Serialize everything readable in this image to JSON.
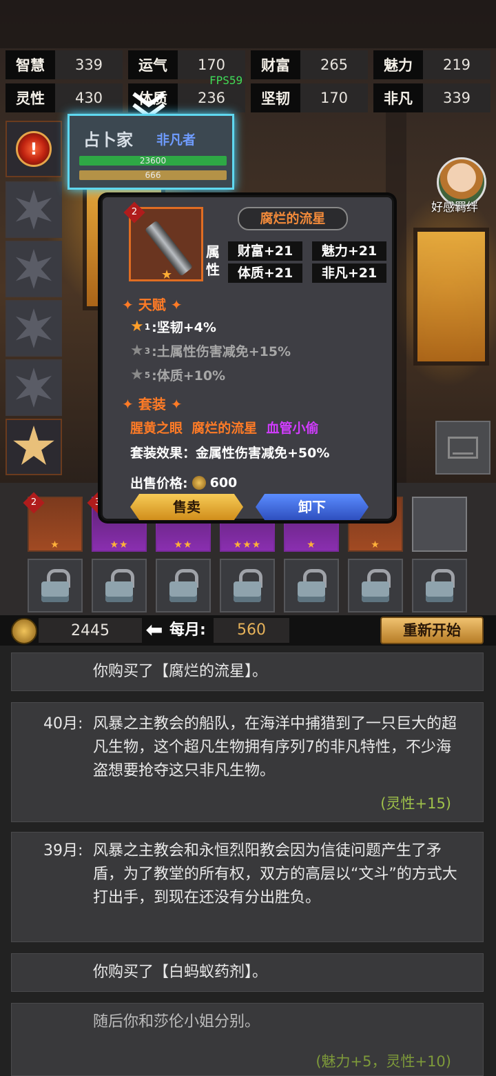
{
  "stats": [
    {
      "label": "智慧",
      "value": "339"
    },
    {
      "label": "运气",
      "value": "170"
    },
    {
      "label": "财富",
      "value": "265"
    },
    {
      "label": "魅力",
      "value": "219"
    },
    {
      "label": "灵性",
      "value": "430"
    },
    {
      "label": "体质",
      "value": "236"
    },
    {
      "label": "坚韧",
      "value": "170"
    },
    {
      "label": "非凡",
      "value": "339"
    }
  ],
  "fps": "FPS59",
  "character": {
    "title": "占卜家",
    "rank": "非凡者",
    "hp": "23600",
    "mp": "666"
  },
  "companion": {
    "label": "好感羁绊"
  },
  "popup": {
    "level_badge": "2",
    "item_name": "腐烂的流星",
    "attr_label": "属性",
    "attrs": [
      "财富+21",
      "魅力+21",
      "体质+21",
      "非凡+21"
    ],
    "talent_title": "天赋",
    "talents": [
      {
        "level": "1",
        "text": ":坚韧+4%"
      },
      {
        "level": "3",
        "text": ":土属性伤害减免+15%"
      },
      {
        "level": "5",
        "text": ":体质+10%"
      }
    ],
    "set_title": "套装",
    "set_items": [
      "腥黄之眼",
      "腐烂的流星",
      "血管小偷"
    ],
    "set_effect": "套装效果：金属性伤害减免+50%",
    "price_label": "出售价格:",
    "price_value": "600",
    "sell_label": "售卖",
    "unequip_label": "卸下"
  },
  "equipment": [
    {
      "badge": "2",
      "stars": "★",
      "rarity": "orange"
    },
    {
      "badge": "3",
      "stars": "★★",
      "rarity": "purple"
    },
    {
      "badge": "",
      "stars": "★★",
      "rarity": "purple"
    },
    {
      "badge": "",
      "stars": "★★★",
      "rarity": "purple"
    },
    {
      "badge": "",
      "stars": "★",
      "rarity": "purple"
    },
    {
      "badge": "",
      "stars": "★",
      "rarity": "orange"
    },
    {
      "badge": "",
      "stars": "",
      "rarity": "grey"
    }
  ],
  "gold": "2445",
  "monthly_label": "每月:",
  "monthly_value": "560",
  "restart_label": "重新开始",
  "log": [
    {
      "month": "",
      "text": "你购买了【腐烂的流星】。",
      "bonus": ""
    },
    {
      "month": "40月:",
      "text": "风暴之主教会的船队，在海洋中捕猎到了一只巨大的超凡生物，这个超凡生物拥有序列7的非凡特性，不少海盗想要抢夺这只非凡生物。",
      "bonus": "(灵性+15)"
    },
    {
      "month": "39月:",
      "text": "风暴之主教会和永恒烈阳教会因为信徒问题产生了矛盾，为了教堂的所有权，双方的高层以“文斗”的方式大打出手，到现在还没有分出胜负。",
      "bonus": ""
    },
    {
      "month": "",
      "text": "你购买了【白蚂蚁药剂】。",
      "bonus": ""
    },
    {
      "month": "",
      "text": "随后你和莎伦小姐分别。",
      "bonus": "(魅力+5，灵性+10)"
    }
  ],
  "colors": {
    "accent_orange": "#ff7b26",
    "set_purple": "#d13cff",
    "bonus_green": "#9fc14a",
    "rank_blue": "#6f9cff"
  }
}
